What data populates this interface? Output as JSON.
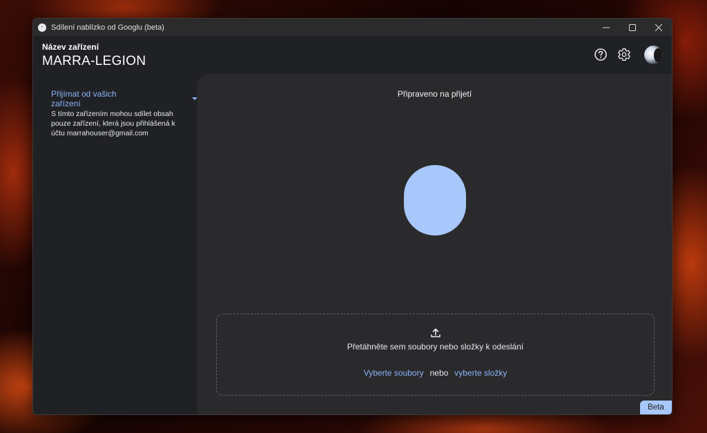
{
  "window": {
    "title": "Sdílení nablízko od Googlu (beta)",
    "app_icon_text": "•"
  },
  "header": {
    "device_label": "Název zařízení",
    "device_name": "MARRA-LEGION",
    "help_icon": "help-circle-icon",
    "settings_icon": "gear-icon"
  },
  "sidebar": {
    "receive_mode": "Přijímat od vašich zařízení",
    "description": "S tímto zařízením mohou sdílet obsah pouze zařízení, která jsou přihlášená k účtu marrahouser@gmail.com"
  },
  "main": {
    "status": "Připraveno na přijetí",
    "drop_text": "Přetáhněte sem soubory nebo složky k odeslání",
    "choose_files": "Vyberte soubory",
    "or": "nebo",
    "choose_folders": "vyberte složky",
    "badge": "Beta"
  },
  "colors": {
    "accent": "#8ab4f8",
    "blob": "#a8c7fa",
    "window_bg": "#202124",
    "panel_bg": "#2a2a2c"
  }
}
